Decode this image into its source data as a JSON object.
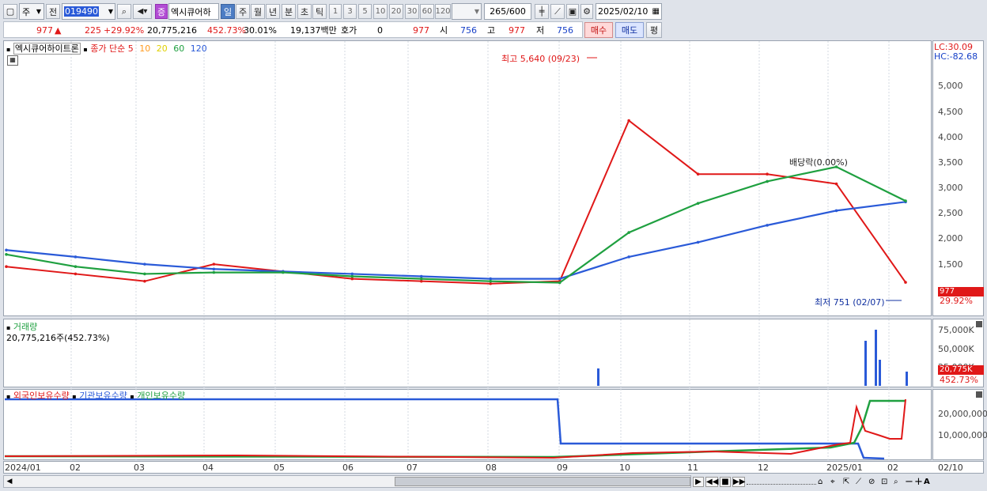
{
  "toolbar": {
    "market_label": "주",
    "prev_label": "전",
    "code_value": "019490",
    "badge_label": "증",
    "stock_name": "엑시큐어하",
    "period_tabs": [
      "일",
      "주",
      "월",
      "년",
      "분",
      "초",
      "틱"
    ],
    "active_period": "일",
    "interval_buttons": [
      "1",
      "3",
      "5",
      "10",
      "20",
      "30",
      "60",
      "120"
    ],
    "count_value": "265",
    "count_total": "/600",
    "date_value": "2025/02/10"
  },
  "quote": {
    "price": "977",
    "change": "225",
    "change_pct": "+29.92%",
    "volume": "20,775,216",
    "volume_pct": "452.73%",
    "turnover": "30.01%",
    "amount": "19,137백만",
    "hoga_label": "호가",
    "hoga_value": "0",
    "hoga_price": "977",
    "open_label": "시",
    "open_value": "756",
    "high_label": "고",
    "high_value": "977",
    "low_label": "저",
    "low_value": "756",
    "buy_label": "매수",
    "sell_label": "매도",
    "avg_label": "평"
  },
  "price_panel": {
    "stock_title": "엑시큐어하이트론",
    "ma_label": "종가 단순",
    "ma_periods": [
      "5",
      "10",
      "20",
      "60",
      "120"
    ],
    "ma_colors": [
      "#e01818",
      "#ff9a1e",
      "#f0f000",
      "#1fa040",
      "#2a5ad8"
    ],
    "high_annotation": "최고 5,640 (09/23)",
    "low_annotation": "최저 751 (02/07)",
    "div_annotation": "배당락(0.00%)",
    "lc": "LC:30.09",
    "hc": "HC:-82.68",
    "last_price_tag": "977",
    "last_pct_tag": "29.92%",
    "yticks": [
      "5,000",
      "4,500",
      "4,000",
      "3,500",
      "3,000",
      "2,500",
      "2,000",
      "1,500"
    ]
  },
  "volume_panel": {
    "title": "거래량",
    "value_text": "20,775,216주(452.73%)",
    "yticks": [
      "75,000K",
      "50,000K",
      "25,000K"
    ],
    "last_tag": "20,775K",
    "last_pct": "452.73%"
  },
  "holdings_panel": {
    "legend": [
      "외국인보유수량",
      "기관보유수량",
      "개인보유수량"
    ],
    "legend_colors": [
      "#e01818",
      "#2a5ad8",
      "#1fa040"
    ],
    "yticks": [
      "20,000,000",
      "10,000,000"
    ]
  },
  "x_labels": [
    "2024/01",
    "02",
    "03",
    "04",
    "05",
    "06",
    "07",
    "08",
    "09",
    "10",
    "11",
    "12",
    "2025/01",
    "02",
    "02/10"
  ],
  "chart_data": {
    "type": "line",
    "title": "엑시큐어하이트론",
    "x": [
      "2024/01",
      "02",
      "03",
      "04",
      "05",
      "06",
      "07",
      "08",
      "09",
      "10",
      "11",
      "12",
      "2025/01",
      "02"
    ],
    "series": [
      {
        "name": "종가",
        "values": [
          1300,
          1150,
          1000,
          1350,
          1200,
          1050,
          1000,
          950,
          1000,
          4300,
          3200,
          3200,
          3000,
          977
        ]
      },
      {
        "name": "120",
        "values": [
          1640,
          1500,
          1350,
          1250,
          1200,
          1150,
          1100,
          1050,
          1050,
          1500,
          1800,
          2150,
          2450,
          2630
        ]
      },
      {
        "name": "60",
        "values": [
          1550,
          1300,
          1150,
          1180,
          1180,
          1100,
          1050,
          1000,
          970,
          2000,
          2600,
          3050,
          3350,
          2650
        ]
      }
    ],
    "ylim": [
      751,
      5640
    ],
    "annotations": {
      "high": "최고 5,640 (09/23)",
      "low": "최저 751 (02/07)"
    }
  }
}
